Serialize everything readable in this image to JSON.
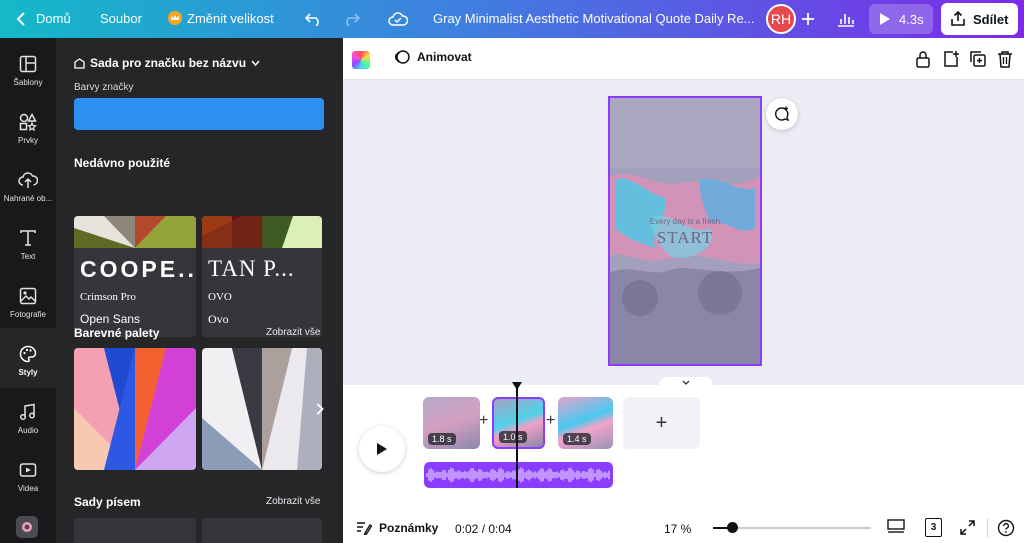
{
  "topbar": {
    "home_label": "Domů",
    "file_label": "Soubor",
    "resize_label": "Změnit velikost",
    "doc_title": "Gray Minimalist Aesthetic Motivational Quote Daily Re...",
    "avatar_initials": "RH",
    "play_duration": "4.3s",
    "share_label": "Sdílet"
  },
  "rail": {
    "items": [
      {
        "label": "Šablony",
        "icon": "template-icon"
      },
      {
        "label": "Prvky",
        "icon": "elements-icon"
      },
      {
        "label": "Nahrané ob...",
        "icon": "upload-icon"
      },
      {
        "label": "Text",
        "icon": "text-icon"
      },
      {
        "label": "Fotografie",
        "icon": "photo-icon"
      },
      {
        "label": "Styly",
        "icon": "styles-icon"
      },
      {
        "label": "Audio",
        "icon": "audio-icon"
      },
      {
        "label": "Videa",
        "icon": "video-icon"
      }
    ]
  },
  "panel": {
    "brand_kit": "Sada pro značku bez názvu",
    "brand_colors_label": "Barvy značky",
    "brand_color": "#2d8ff0",
    "recent_heading": "Nedávno použité",
    "font_cards": [
      {
        "big": "COOPE...",
        "font1": "Crimson Pro",
        "font2": "Open Sans"
      },
      {
        "big": "TAN P...",
        "font1": "OVO",
        "font2": "Ovo"
      }
    ],
    "palettes_heading": "Barevné palety",
    "palettes_show_all": "Zobrazit vše",
    "fonts_heading": "Sady písem",
    "fonts_show_all": "Zobrazit vše"
  },
  "editor": {
    "animate_label": "Animovat",
    "quote_small": "Every day is a fresh",
    "quote_big": "START"
  },
  "timeline": {
    "clips": [
      {
        "duration": "1.8 s"
      },
      {
        "duration": "1.0 s"
      },
      {
        "duration": "1.4 s"
      }
    ],
    "add_symbol": "+"
  },
  "bottom": {
    "notes_label": "Poznámky",
    "time": "0:02 / 0:04",
    "zoom": "17 %",
    "page_count": "3",
    "zoom_fraction": 0.12
  },
  "colors": {
    "accent": "#8b3dff",
    "gradient_start": "#13b9c8",
    "gradient_end": "#7d2ae8"
  }
}
